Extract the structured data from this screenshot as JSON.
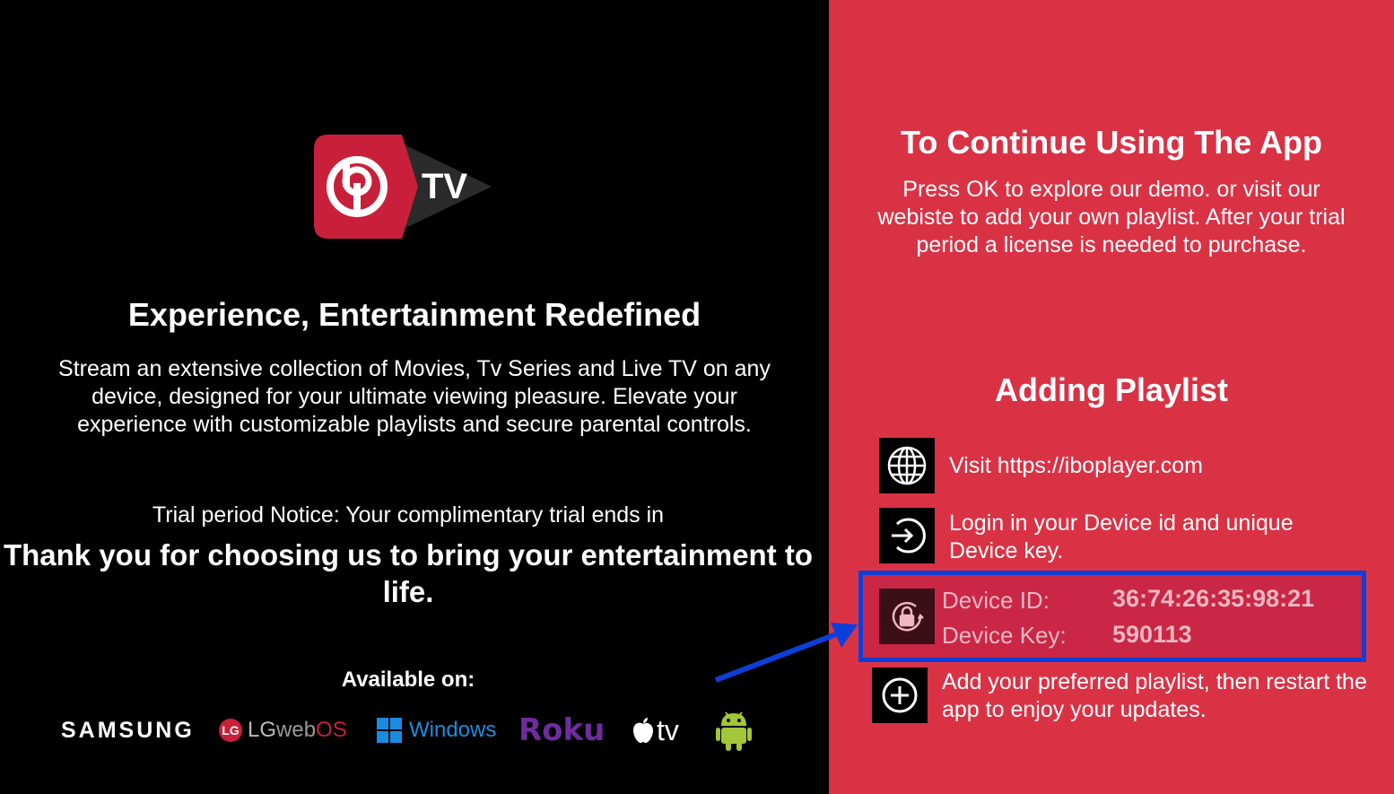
{
  "brand": {
    "logo_text": "TV"
  },
  "left": {
    "tagline": "Experience, Entertainment Redefined",
    "description": "Stream an extensive collection of Movies, Tv Series and Live TV on any device, designed for your ultimate viewing pleasure. Elevate your experience with customizable playlists and secure parental controls.",
    "trial_notice": "Trial period Notice: Your complimentary trial ends in",
    "thanks": "Thank you for choosing us to bring your entertainment to life.",
    "available_on": "Available on:",
    "platforms": {
      "samsung": "SAMSUNG",
      "lg": "LG",
      "lg_web": "web",
      "lg_os": "OS",
      "windows": "Windows",
      "roku": "Roku",
      "appletv": "tv"
    }
  },
  "right": {
    "title": "To Continue Using The App",
    "description": "Press OK to explore our demo. or visit our webiste to add your own playlist. After your trial period a license is needed to purchase.",
    "subtitle": "Adding Playlist",
    "steps": [
      {
        "icon": "globe-icon",
        "text": "Visit https://iboplayer.com"
      },
      {
        "icon": "login-icon",
        "text": "Login in your Device id and unique Device key."
      },
      {
        "icon": "plus-circle-icon",
        "text": "Add your preferred playlist, then restart the app to enjoy your updates."
      }
    ],
    "device": {
      "icon": "lock-refresh-icon",
      "id_label": "Device ID:",
      "id_value": "36:74:26:35:98:21",
      "key_label": "Device Key:",
      "key_value": "590113"
    }
  },
  "colors": {
    "panel": "#da3245",
    "highlight_border": "#0d3fd8",
    "arrow": "#0d3fd8"
  }
}
